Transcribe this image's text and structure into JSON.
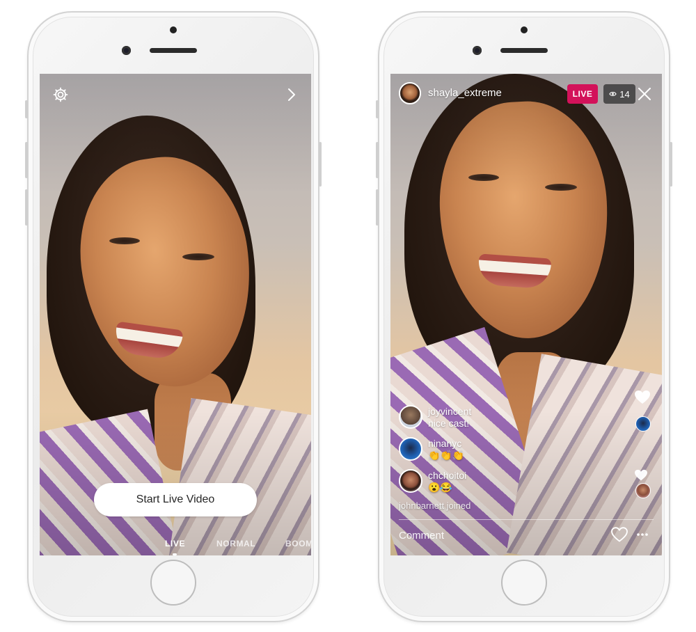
{
  "colors": {
    "live_badge": "#d3125a",
    "viewers_badge_bg": "#2d2d2d",
    "button_bg": "#ffffff",
    "button_text": "#262626",
    "overlay_text": "#ffffff"
  },
  "left_screen": {
    "icons": {
      "settings": "gear-icon",
      "next": "chevron-right-icon"
    },
    "start_button_label": "Start Live Video",
    "mode_tabs": [
      "LIVE",
      "NORMAL",
      "BOOM"
    ],
    "active_tab": "LIVE"
  },
  "right_screen": {
    "host_username": "shayla_extreme",
    "live_label": "LIVE",
    "viewer_count": "14",
    "icons": {
      "viewers": "eye-icon",
      "close": "close-icon",
      "like": "heart-icon",
      "more": "more-icon"
    },
    "comments": [
      {
        "user": "joyvincent",
        "text": "nice cast!"
      },
      {
        "user": "ninanyc",
        "text": "👏👏👏"
      },
      {
        "user": "chchoitoi",
        "text": "😮😂"
      }
    ],
    "joined_notice": "johnbarnett joined",
    "comment_placeholder": "Comment"
  }
}
